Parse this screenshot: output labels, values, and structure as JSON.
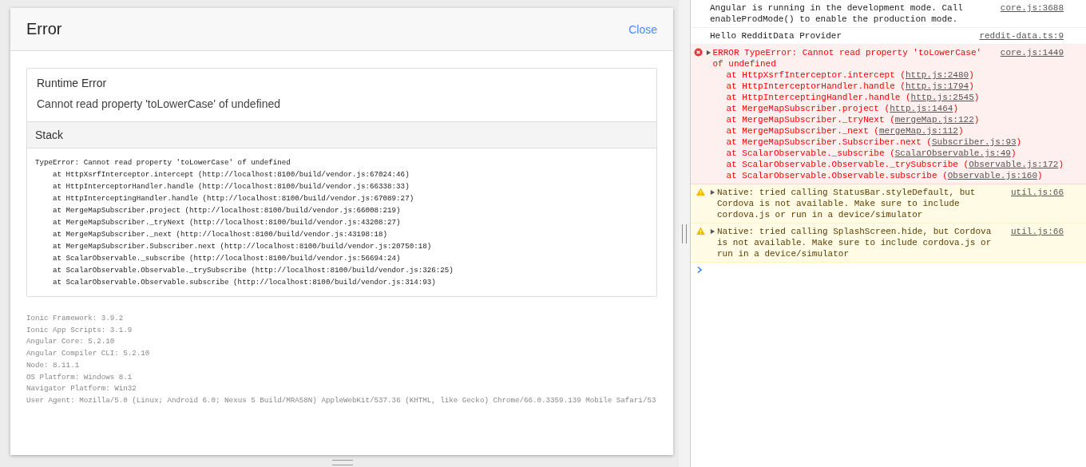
{
  "modal": {
    "title": "Error",
    "close": "Close",
    "runtime_error": {
      "heading": "Runtime Error",
      "message": "Cannot read property 'toLowerCase' of undefined"
    },
    "stack": {
      "heading": "Stack",
      "lines": [
        "TypeError: Cannot read property 'toLowerCase' of undefined",
        "    at HttpXsrfInterceptor.intercept (http://localhost:8100/build/vendor.js:67024:46)",
        "    at HttpInterceptorHandler.handle (http://localhost:8100/build/vendor.js:66338:33)",
        "    at HttpInterceptingHandler.handle (http://localhost:8100/build/vendor.js:67089:27)",
        "    at MergeMapSubscriber.project (http://localhost:8100/build/vendor.js:66008:219)",
        "    at MergeMapSubscriber._tryNext (http://localhost:8100/build/vendor.js:43208:27)",
        "    at MergeMapSubscriber._next (http://localhost:8100/build/vendor.js:43198:18)",
        "    at MergeMapSubscriber.Subscriber.next (http://localhost:8100/build/vendor.js:20750:18)",
        "    at ScalarObservable._subscribe (http://localhost:8100/build/vendor.js:56694:24)",
        "    at ScalarObservable.Observable._trySubscribe (http://localhost:8100/build/vendor.js:326:25)",
        "    at ScalarObservable.Observable.subscribe (http://localhost:8100/build/vendor.js:314:93)"
      ]
    },
    "environment": [
      "Ionic Framework: 3.9.2",
      "Ionic App Scripts: 3.1.9",
      "Angular Core: 5.2.10",
      "Angular Compiler CLI: 5.2.10",
      "Node: 8.11.1",
      "OS Platform: Windows 8.1",
      "Navigator Platform: Win32",
      "User Agent: Mozilla/5.0 (Linux; Android 6.0; Nexus 5 Build/MRA58N) AppleWebKit/537.36 (KHTML, like Gecko) Chrome/66.0.3359.139 Mobile Safari/53"
    ]
  },
  "console": {
    "messages": [
      {
        "kind": "info",
        "text": "Angular is running in the development mode. Call enableProdMode() to enable the production mode.",
        "source": "core.js:3688"
      },
      {
        "kind": "info",
        "text": "Hello RedditData Provider",
        "source": "reddit-data.ts:9"
      },
      {
        "kind": "error",
        "text": "ERROR TypeError: Cannot read property 'toLowerCase' of undefined",
        "source": "core.js:1449",
        "stack": [
          {
            "prefix": "at HttpXsrfInterceptor.intercept (",
            "link": "http.js:2480",
            "suffix": ")"
          },
          {
            "prefix": "at HttpInterceptorHandler.handle (",
            "link": "http.js:1794",
            "suffix": ")"
          },
          {
            "prefix": "at HttpInterceptingHandler.handle (",
            "link": "http.js:2545",
            "suffix": ")"
          },
          {
            "prefix": "at MergeMapSubscriber.project (",
            "link": "http.js:1464",
            "suffix": ")"
          },
          {
            "prefix": "at MergeMapSubscriber._tryNext (",
            "link": "mergeMap.js:122",
            "suffix": ")"
          },
          {
            "prefix": "at MergeMapSubscriber._next (",
            "link": "mergeMap.js:112",
            "suffix": ")"
          },
          {
            "prefix": "at MergeMapSubscriber.Subscriber.next (",
            "link": "Subscriber.js:93",
            "suffix": ")"
          },
          {
            "prefix": "at ScalarObservable._subscribe (",
            "link": "ScalarObservable.js:49",
            "suffix": ")"
          },
          {
            "prefix": "at ScalarObservable.Observable._trySubscribe (",
            "link": "Observable.js:172",
            "suffix": ")"
          },
          {
            "prefix": "at ScalarObservable.Observable.subscribe (",
            "link": "Observable.js:160",
            "suffix": ")"
          }
        ]
      },
      {
        "kind": "warning",
        "text": "Native: tried calling StatusBar.styleDefault, but Cordova is not available. Make sure to include cordova.js or run in a device/simulator",
        "source": "util.js:66"
      },
      {
        "kind": "warning",
        "text": "Native: tried calling SplashScreen.hide, but Cordova is not available. Make sure to include cordova.js or run in a device/simulator",
        "source": "util.js:66"
      }
    ]
  }
}
